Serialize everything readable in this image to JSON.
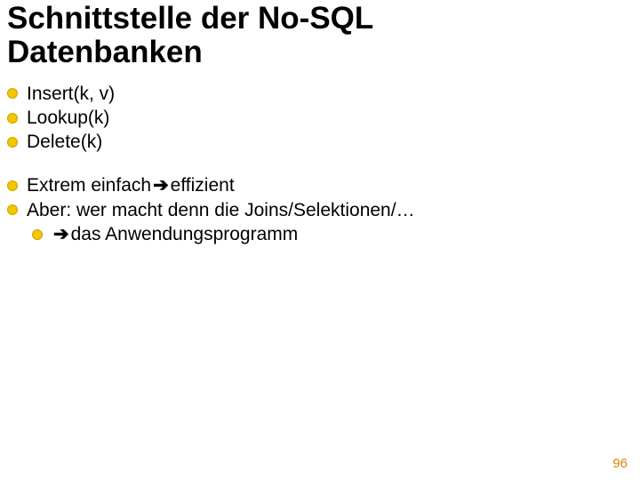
{
  "title_line1": "Schnittstelle der No-SQL",
  "title_line2": "Datenbanken",
  "group1": {
    "item1": "Insert(k, v)",
    "item2": "Lookup(k)",
    "item3": "Delete(k)"
  },
  "group2": {
    "item1_pre": "Extrem einfach ",
    "item1_post": " effizient",
    "item2": "Aber: wer macht denn die Joins/Selektionen/…",
    "sub1_post": " das Anwendungsprogramm"
  },
  "arrow_glyph": "➔",
  "page_number": "96"
}
